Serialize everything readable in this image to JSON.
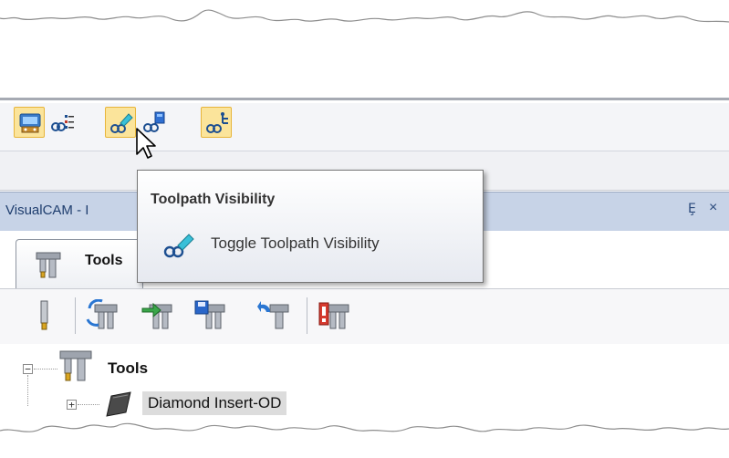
{
  "toolbar": {
    "buttons": [
      {
        "name": "machine-setup-icon",
        "active": true
      },
      {
        "name": "operations-list-icon",
        "active": false
      },
      {
        "name": "toolpath-visibility-icon",
        "active": true
      },
      {
        "name": "stock-visibility-icon",
        "active": false
      },
      {
        "name": "toolpath-tree-icon",
        "active": true
      }
    ]
  },
  "tooltip": {
    "title": "Toolpath Visibility",
    "command": "Toggle Toolpath Visibility",
    "icon": "toolpath-visibility-icon"
  },
  "panel": {
    "title": "VisualCAM - I",
    "pin_glyph": "Ȩ",
    "close_glyph": "×"
  },
  "tabs": [
    {
      "label": "Tools",
      "icon": "tools-icon"
    }
  ],
  "panel_toolbar": [
    "new-tool-icon",
    "edit-tool-icon",
    "import-tool-icon",
    "save-tool-icon",
    "undo-tool-icon",
    "delete-tool-icon"
  ],
  "tree": {
    "root": {
      "label": "Tools",
      "expander": "−"
    },
    "children": [
      {
        "label": "Diamond Insert-OD",
        "expander": "+",
        "selected": true
      }
    ]
  },
  "colors": {
    "active_button_bg": "#fbe49b",
    "panel_title_bg": "#c7d3e7",
    "panel_title_text": "#1e3d6e"
  }
}
